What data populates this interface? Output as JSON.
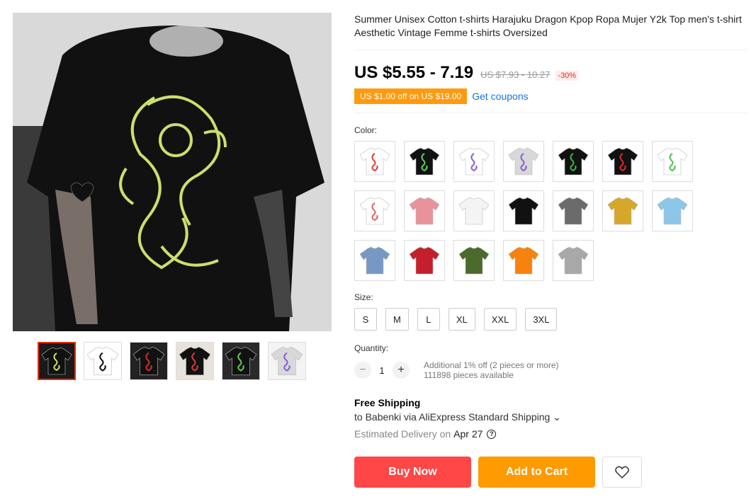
{
  "product": {
    "title": "Summer Unisex Cotton t-shirts Harajuku Dragon Kpop Ropa Mujer Y2k Top men's t-shirt Aesthetic Vintage Femme t-shirts Oversized",
    "price": "US $5.55 - 7.19",
    "original_price": "US $7.93 - 10.27",
    "discount": "-30%",
    "coupon_tag": "US $1.00 off on US $19.00",
    "get_coupons": "Get coupons"
  },
  "color": {
    "label": "Color:",
    "swatches": [
      {
        "icon": "tshirt-white-red-dragon",
        "shirt": "#ffffff",
        "print": "#e03a3a"
      },
      {
        "icon": "tshirt-black-green-dragon",
        "shirt": "#111111",
        "print": "#5fd05f"
      },
      {
        "icon": "tshirt-white-purple-dragon",
        "shirt": "#ffffff",
        "print": "#8a5bd6"
      },
      {
        "icon": "tshirt-grey-purple-dragon",
        "shirt": "#d8d8d8",
        "print": "#8a5bd6"
      },
      {
        "icon": "tshirt-black-green-dragon-2",
        "shirt": "#111111",
        "print": "#2fbf3a"
      },
      {
        "icon": "tshirt-black-red-dragon",
        "shirt": "#111111",
        "print": "#d92b2b"
      },
      {
        "icon": "tshirt-white-green-dragon",
        "shirt": "#ffffff",
        "print": "#4cc04c"
      },
      {
        "icon": "tshirt-white-red-dragon-2",
        "shirt": "#ffffff",
        "print": "#e06060"
      },
      {
        "icon": "tshirt-pink",
        "shirt": "#e8939a",
        "print": ""
      },
      {
        "icon": "tshirt-white-plain",
        "shirt": "#f4f4f4",
        "print": ""
      },
      {
        "icon": "tshirt-black-plain",
        "shirt": "#111111",
        "print": ""
      },
      {
        "icon": "tshirt-dark-grey",
        "shirt": "#6b6b6b",
        "print": ""
      },
      {
        "icon": "tshirt-mustard",
        "shirt": "#d6a72a",
        "print": ""
      },
      {
        "icon": "tshirt-light-blue",
        "shirt": "#8cc7ea",
        "print": ""
      },
      {
        "icon": "tshirt-denim-blue",
        "shirt": "#7698c4",
        "print": ""
      },
      {
        "icon": "tshirt-red",
        "shirt": "#c3202b",
        "print": ""
      },
      {
        "icon": "tshirt-army-green",
        "shirt": "#4a6b2c",
        "print": ""
      },
      {
        "icon": "tshirt-orange",
        "shirt": "#f7830f",
        "print": ""
      },
      {
        "icon": "tshirt-light-grey",
        "shirt": "#a8a8a8",
        "print": ""
      }
    ]
  },
  "size": {
    "label": "Size:",
    "options": [
      "S",
      "M",
      "L",
      "XL",
      "XXL",
      "3XL"
    ]
  },
  "quantity": {
    "label": "Quantity:",
    "minus": "−",
    "value": "1",
    "plus": "+",
    "additional": "Additional 1% off (2 pieces or more)",
    "available": "111898 pieces available"
  },
  "shipping": {
    "title": "Free Shipping",
    "to": "to Babenki via AliExpress Standard Shipping ⌄",
    "estimated_label": "Estimated Delivery on",
    "date": "Apr 27",
    "help": "?"
  },
  "actions": {
    "buy_now": "Buy Now",
    "add_to_cart": "Add to Cart",
    "wishlist_icon": "heart-icon"
  },
  "gallery": {
    "thumbs": [
      {
        "icon": "thumb-black-green-dragon",
        "bg": "#1a1a1a",
        "print": "#c9e06b"
      },
      {
        "icon": "thumb-size-chart",
        "bg": "#ffffff",
        "print": "#111111"
      },
      {
        "icon": "thumb-black-red-dragon",
        "bg": "#222222",
        "print": "#cf2b2b"
      },
      {
        "icon": "thumb-white-red-dragon",
        "bg": "#e8e2dc",
        "print": "#d33a3a"
      },
      {
        "icon": "thumb-black-green-dragon-2",
        "bg": "#2a2a2a",
        "print": "#6ac04f"
      },
      {
        "icon": "thumb-grey-purple-dragon",
        "bg": "#f4f4f4",
        "print": "#8a5bd6"
      }
    ]
  },
  "colors": {
    "accent_red": "#ff4747",
    "accent_orange": "#ff9a00",
    "link_blue": "#1a73e8",
    "discount_red": "#e62e04"
  }
}
